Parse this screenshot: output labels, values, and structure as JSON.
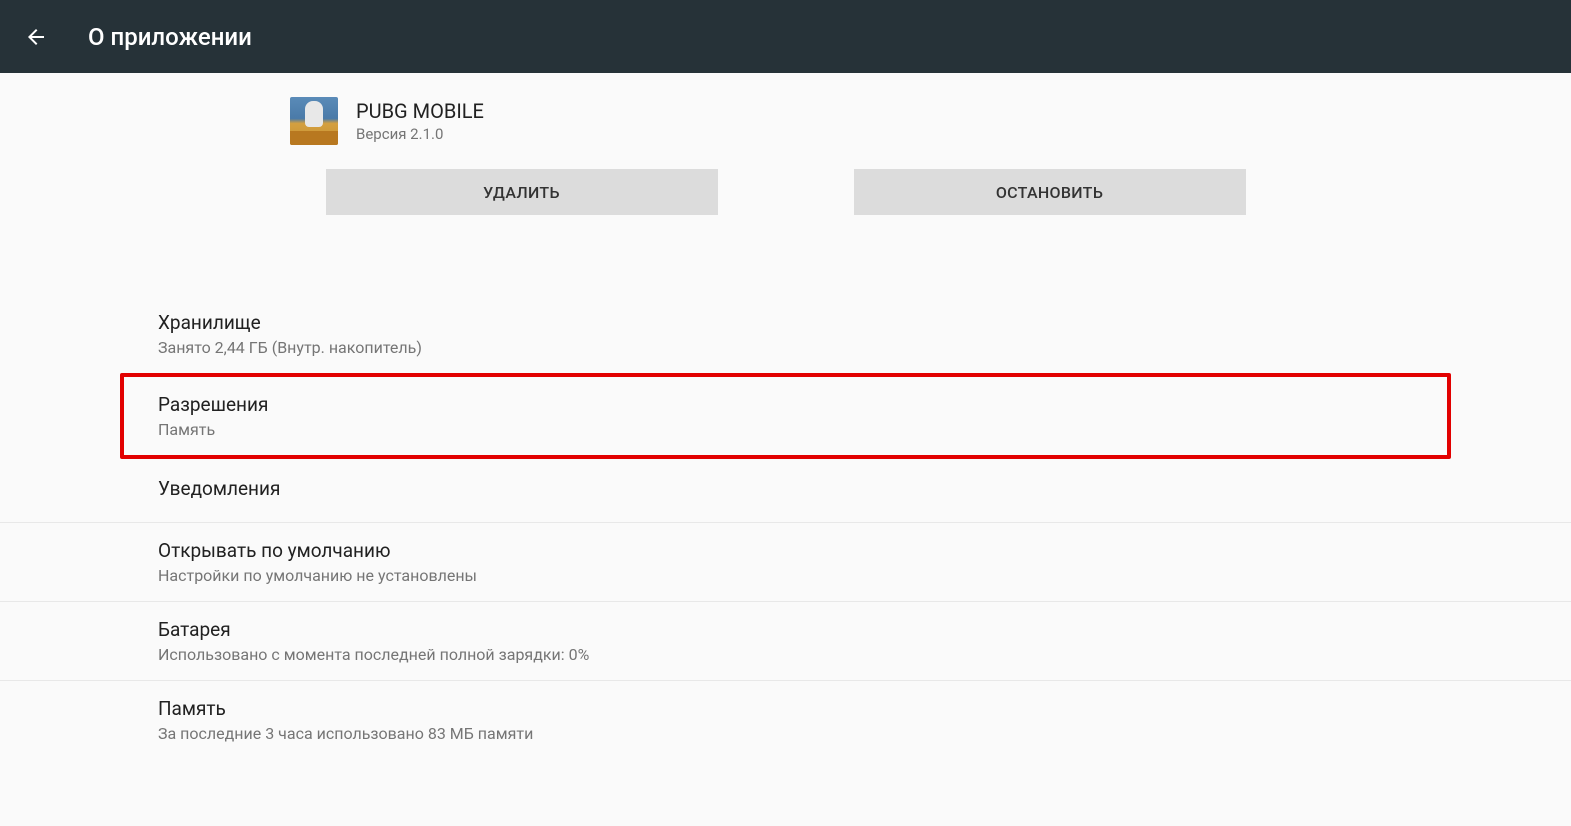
{
  "header": {
    "title": "О приложении"
  },
  "app": {
    "name": "PUBG MOBILE",
    "version": "Версия 2.1.0"
  },
  "buttons": {
    "uninstall": "УДАЛИТЬ",
    "stop": "ОСТАНОВИТЬ"
  },
  "items": {
    "storage": {
      "title": "Хранилище",
      "subtitle": "Занято 2,44 ГБ (Внутр. накопитель)"
    },
    "permissions": {
      "title": "Разрешения",
      "subtitle": "Память"
    },
    "notifications": {
      "title": "Уведомления"
    },
    "default": {
      "title": "Открывать по умолчанию",
      "subtitle": "Настройки по умолчанию не установлены"
    },
    "battery": {
      "title": "Батарея",
      "subtitle": "Использовано с момента последней полной зарядки: 0%"
    },
    "memory": {
      "title": "Память",
      "subtitle": "За последние 3 часа использовано 83 МБ памяти"
    }
  }
}
